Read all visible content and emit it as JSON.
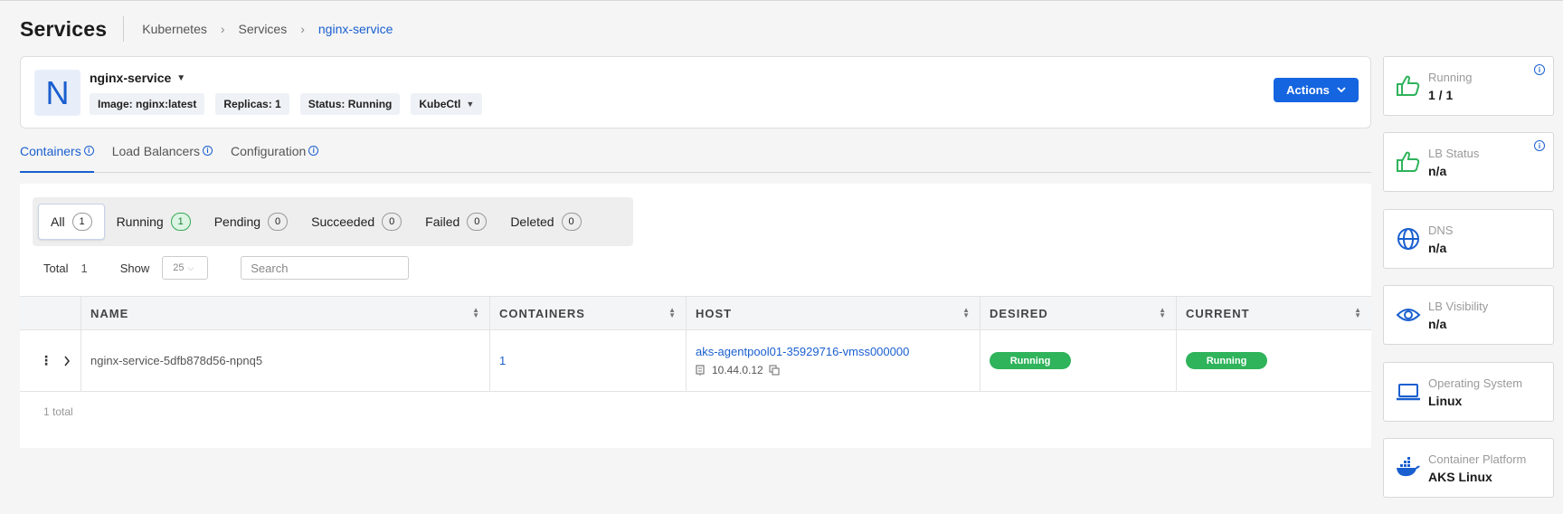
{
  "header": {
    "title": "Services",
    "breadcrumb": [
      "Kubernetes",
      "Services",
      "nginx-service"
    ]
  },
  "service": {
    "avatar_letter": "N",
    "name": "nginx-service",
    "tags": [
      "Image: nginx:latest",
      "Replicas: 1",
      "Status: Running"
    ],
    "kubectl_label": "KubeCtl",
    "actions_label": "Actions"
  },
  "tabs": [
    {
      "label": "Containers",
      "active": true
    },
    {
      "label": "Load Balancers",
      "active": false
    },
    {
      "label": "Configuration",
      "active": false
    }
  ],
  "filters": [
    {
      "label": "All",
      "count": "1"
    },
    {
      "label": "Running",
      "count": "1"
    },
    {
      "label": "Pending",
      "count": "0"
    },
    {
      "label": "Succeeded",
      "count": "0"
    },
    {
      "label": "Failed",
      "count": "0"
    },
    {
      "label": "Deleted",
      "count": "0"
    }
  ],
  "toolbar": {
    "total_label": "Total",
    "total_value": "1",
    "show_label": "Show",
    "show_value": "25",
    "search_placeholder": "Search"
  },
  "table": {
    "columns": [
      "NAME",
      "CONTAINERS",
      "HOST",
      "DESIRED",
      "CURRENT"
    ],
    "rows": [
      {
        "name": "nginx-service-5dfb878d56-npnq5",
        "containers": "1",
        "host": "aks-agentpool01-35929716-vmss000000",
        "ip": "10.44.0.12",
        "desired": "Running",
        "current": "Running"
      }
    ],
    "footer": "1 total"
  },
  "stats": [
    {
      "label": "Running",
      "value": "1 / 1",
      "icon": "thumbs-up-icon",
      "info": true
    },
    {
      "label": "LB Status",
      "value": "n/a",
      "icon": "thumbs-up-icon",
      "info": true
    },
    {
      "label": "DNS",
      "value": "n/a",
      "icon": "globe-icon",
      "info": false
    },
    {
      "label": "LB Visibility",
      "value": "n/a",
      "icon": "eye-icon",
      "info": false
    },
    {
      "label": "Operating System",
      "value": "Linux",
      "icon": "laptop-icon",
      "info": false
    },
    {
      "label": "Container Platform",
      "value": "AKS Linux",
      "icon": "docker-icon",
      "info": false
    }
  ],
  "colors": {
    "accent": "#1565e0",
    "running_green": "#2fb35b",
    "icon_green": "#2fb35b",
    "icon_blue": "#1a5fcf"
  }
}
